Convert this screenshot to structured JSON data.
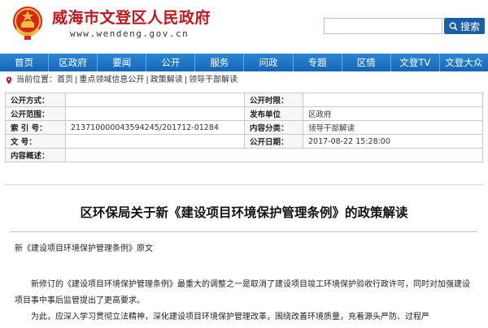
{
  "header": {
    "site_title": "威海市文登区人民政府",
    "site_url": "www.wendeng.gov.cn",
    "search_placeholder": "",
    "search_label": "搜索"
  },
  "nav": [
    "首页",
    "区政府",
    "要闻",
    "公开",
    "服务",
    "问政",
    "专题",
    "区情",
    "文登TV",
    "文登大众"
  ],
  "breadcrumb": {
    "prefix": "当前位置：",
    "items": [
      "首页",
      "重点领域信息公开",
      "政策解读",
      "领导干部解读"
    ],
    "separator": "|"
  },
  "info_table": {
    "row1": {
      "k1": "公开方式：",
      "v1": "",
      "k2": "公开时限：",
      "v2": ""
    },
    "row2": {
      "k1": "公开范围：",
      "v1": "",
      "k2": "发布单位",
      "v2": "区政府"
    },
    "row3": {
      "k1": "索 引 号：",
      "v1": "213710000043594245/201712-01284",
      "k2": "内容分类：",
      "v2": "领导干部解读"
    },
    "row4": {
      "k1": "文    号：",
      "v1": "",
      "k2": "公开日期：",
      "v2": "2017-08-22 15:28:00"
    },
    "row5": {
      "k1": "内容概述：",
      "v1": ""
    }
  },
  "article": {
    "title": "区环保局关于新《建设项目环境保护管理条例》的政策解读",
    "subtitle": "新《建设项目环境保护管理条例》原文",
    "paragraph1": "新修订的《建设项目环境保护管理条例》最重大的调整之一是取消了建设项目竣工环境保护验收行政许可，同时对加强建设项目事中事后监管提出了更高要求。",
    "paragraph2": "为此，应深入学习贯彻立法精神，深化建设项目环境保护管理改革，围绕改善环境质量，充着源头严防、过程严"
  },
  "colors": {
    "brand_red": "#c4161c",
    "nav_blue": "#1667b6",
    "button_blue": "#1a5fa6"
  }
}
